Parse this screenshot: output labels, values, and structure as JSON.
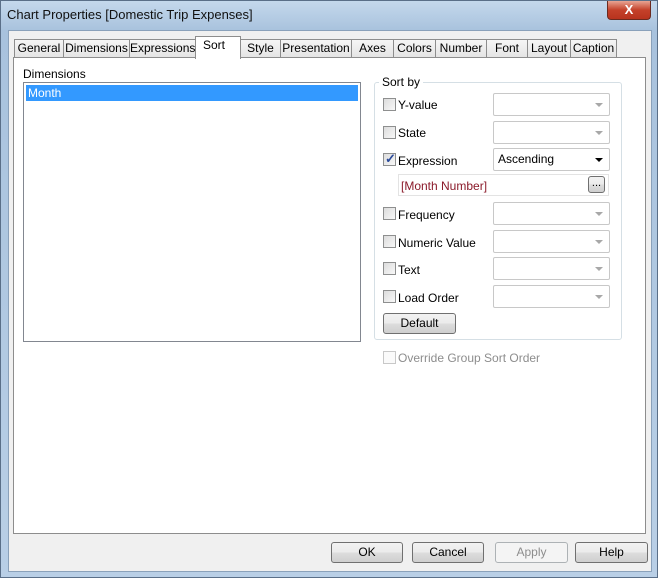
{
  "window": {
    "title": "Chart Properties [Domestic Trip Expenses]",
    "close_label": "X"
  },
  "tabs": [
    {
      "label": "General"
    },
    {
      "label": "Dimensions"
    },
    {
      "label": "Expressions"
    },
    {
      "label": "Sort",
      "selected": true
    },
    {
      "label": "Style"
    },
    {
      "label": "Presentation"
    },
    {
      "label": "Axes"
    },
    {
      "label": "Colors"
    },
    {
      "label": "Number"
    },
    {
      "label": "Font"
    },
    {
      "label": "Layout"
    },
    {
      "label": "Caption"
    }
  ],
  "dimensions": {
    "label": "Dimensions",
    "items": [
      "Month"
    ],
    "selected": "Month"
  },
  "sort_by": {
    "label": "Sort by",
    "options": [
      {
        "label": "Y-value",
        "checked": false,
        "order": ""
      },
      {
        "label": "State",
        "checked": false,
        "order": ""
      },
      {
        "label": "Expression",
        "checked": true,
        "order": "Ascending"
      },
      {
        "label": "Frequency",
        "checked": false,
        "order": ""
      },
      {
        "label": "Numeric Value",
        "checked": false,
        "order": ""
      },
      {
        "label": "Text",
        "checked": false,
        "order": ""
      },
      {
        "label": "Load Order",
        "checked": false,
        "order": ""
      }
    ],
    "expression_value": "[Month Number]",
    "expression_button": "...",
    "default_button": "Default"
  },
  "override_group_sort": {
    "label": "Override Group Sort Order",
    "checked": false,
    "enabled": false
  },
  "footer": {
    "ok": "OK",
    "cancel": "Cancel",
    "apply": "Apply",
    "help": "Help"
  }
}
